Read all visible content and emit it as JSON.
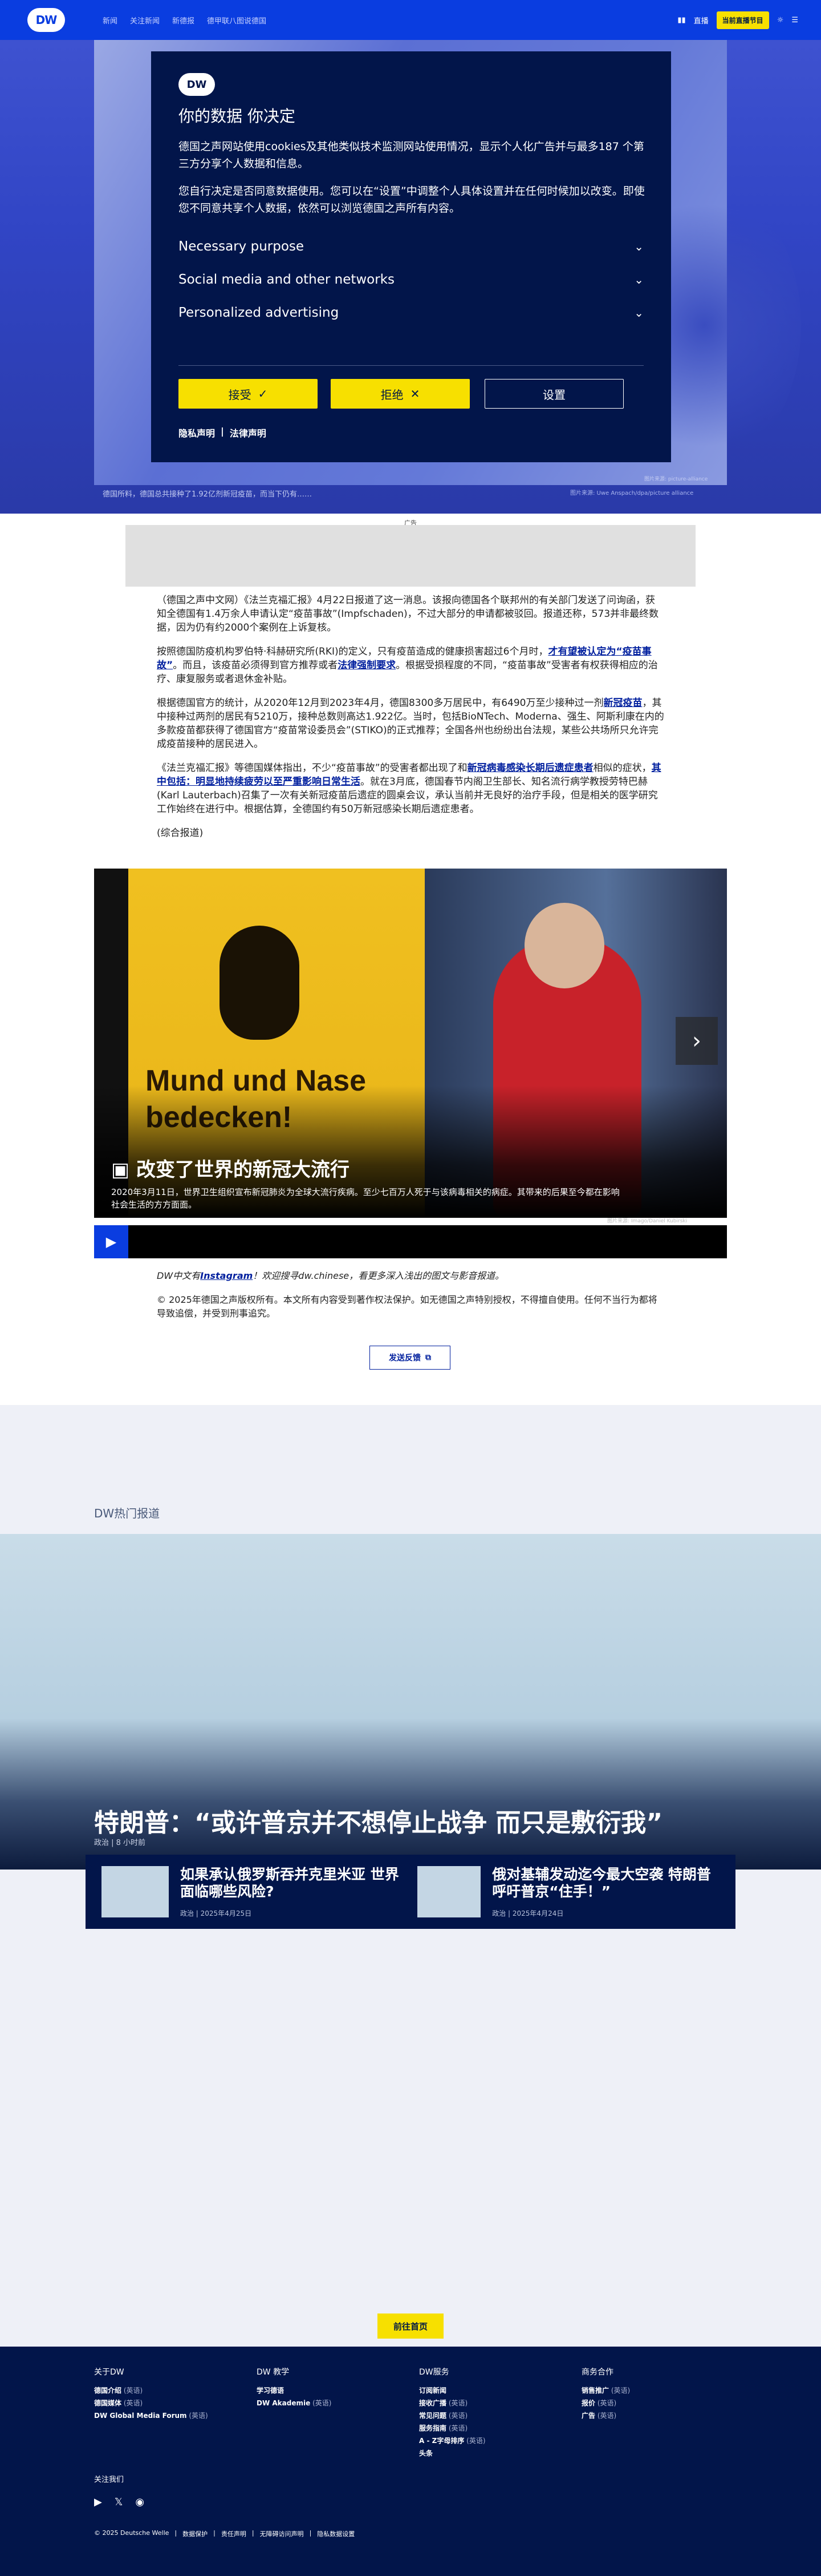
{
  "header": {
    "logo": "DW",
    "nav": [
      "新闻",
      "关注新闻",
      "新德报",
      "德甲联八图说德国"
    ],
    "live_label": "直播",
    "live_tv": "当前直播节目",
    "lang_icon": "globe-icon",
    "menu_icon": "menu-icon"
  },
  "hero": {
    "caption": "德国所料，德国总共接种了1.92亿剂新冠疫苗，而当下仍有……",
    "credit": "图片来源: Uwe Anspach/dpa/picture alliance",
    "credit_small": "图片来源: picture-alliance"
  },
  "consent": {
    "logo": "DW",
    "title": "你的数据 你决定",
    "p1": "德国之声网站使用cookies及其他类似技术监测网站使用情况，显示个人化广告并与最多187 个第三方分享个人数据和信息。",
    "p2": "您自行决定是否同意数据使用。您可以在“设置”中调整个人具体设置并在任何时候加以改变。即使您不同意共享个人数据，依然可以浏览德国之声所有内容。",
    "rows": [
      "Necessary purpose",
      "Social media and other networks",
      "Personalized advertising"
    ],
    "accept": "接受",
    "reject": "拒绝",
    "settings": "设置",
    "privacy": "隐私声明",
    "legal": "法律声明"
  },
  "ad": {
    "label": "广告"
  },
  "article": {
    "p1": "（德国之声中文网）《法兰克福汇报》4月22日报道了这一消息。该报向德国各个联邦州的有关部门发送了问询函，获知全德国有1.4万余人申请认定“疫苗事故”(Impfschaden)，不过大部分的申请都被驳回。报道还称，573并非最终数据，因为仍有约2000个案例在上诉复核。",
    "p2a": "按照德国防疫机构罗伯特·科赫研究所(RKI)的定义，只有疫苗造成的健康损害超过6个月时，",
    "p2_link1": "才有望被认定为“疫苗事故”",
    "p2b": "。而且，该疫苗必须得到官方推荐或者",
    "p2_link2": "法律强制要求",
    "p2c": "。根据受损程度的不同，“疫苗事故”受害者有权获得相应的治疗、康复服务或者退休金补贴。",
    "p3a": "根据德国官方的统计，从2020年12月到2023年4月，德国8300多万居民中，有6490万至少接种过一剂",
    "p3_link": "新冠疫苗",
    "p3b": "，其中接种过两剂的居民有5210万，接种总数则高达1.922亿。当时，包括BioNTech、Moderna、强生、阿斯利康在内的多款疫苗都获得了德国官方“疫苗常设委员会”(STIKO)的正式推荐；全国各州也纷纷出台法规，某些公共场所只允许完成疫苗接种的居民进入。",
    "p4a": "《法兰克福汇报》等德国媒体指出，不少“疫苗事故”的受害者都出现了和",
    "p4_link1": "新冠病毒感染长期后遗症患者",
    "p4b": "相似的症状，",
    "p4_link2": "其中包括：明显地持续疲劳以至严重影响日常生活",
    "p4c": "。就在3月底，德国春节内阁卫生部长、知名流行病学教授劳特巴赫(Karl Lauterbach)召集了一次有关新冠疫苗后遗症的圆桌会议，承认当前并无良好的治疗手段，但是相关的医学研究工作始终在进行中。根据估算，全德国约有50万新冠感染长期后遗症患者。",
    "p5": "(综合报道)"
  },
  "gallery": {
    "sign_text": "Mund und Nase bedecken!",
    "title": "改变了世界的新冠大流行",
    "gallery_icon": "gallery-icon",
    "desc": "2020年3月11日，世界卫生组织宣布新冠肺炎为全球大流行疾病。至少七百万人死于与该病毒相关的病症。其带来的后果至今都在影响社会生活的方方面面。",
    "credit": "图片来源: Imago/Daniel Kubirski",
    "next_icon": "chevron-right-icon",
    "play_icon": "play-icon"
  },
  "footer_notes": {
    "insta_prefix": "DW中文有",
    "insta_link": "Instagram",
    "insta_suffix": "！欢迎搜寻dw.chinese，看更多深入浅出的图文与影音报道。",
    "copyright": "© 2025年德国之声版权所有。本文所有内容受到著作权法保护。如无德国之声特别授权，不得擅自使用。任何不当行为都将导致追偿，并受到刑事追究。",
    "feedback": "发送反馈",
    "feedback_icon": "copy-icon"
  },
  "hot": {
    "title": "DW热门报道",
    "headline": "特朗普：“或许普京并不想停止战争 而只是敷衍我”",
    "headline_meta": "政治 | 8 小时前",
    "cards": [
      {
        "title": "如果承认俄罗斯吞并克里米亚 世界面临哪些风险?",
        "meta": "政治 | 2025年4月25日"
      },
      {
        "title": "俄对基辅发动迄今最大空袭 特朗普呼吁普京“住手！”",
        "meta": "政治 | 2025年4月24日"
      }
    ]
  },
  "back_to_top": "前往首页",
  "footer": {
    "col1": {
      "title": "关于DW",
      "items": [
        [
          "德国介绍",
          "(英语)"
        ],
        [
          "德国媒体",
          "(英语)"
        ],
        [
          "DW Global Media Forum",
          "(英语)"
        ]
      ]
    },
    "col2": {
      "title": "DW 教学",
      "items": [
        [
          "学习德语",
          ""
        ],
        [
          "DW Akademie",
          "(英语)"
        ]
      ]
    },
    "col3": {
      "title": "DW服务",
      "items": [
        [
          "订阅新闻",
          ""
        ],
        [
          "接收广播",
          "(英语)"
        ],
        [
          "常见问题",
          "(英语)"
        ],
        [
          "服务指南",
          "(英语)"
        ],
        [
          "A - Z字母排序",
          "(英语)"
        ],
        [
          "头条",
          ""
        ]
      ]
    },
    "col4": {
      "title": "商务合作",
      "items": [
        [
          "销售推广",
          "(英语)"
        ],
        [
          "报价",
          "(英语)"
        ],
        [
          "广告",
          "(英语)"
        ]
      ]
    },
    "follow": "关注我们",
    "bar": [
      "© 2025 Deutsche Welle",
      "数据保护",
      "责任声明",
      "无障碍访问声明",
      "隐私数据设置"
    ]
  }
}
